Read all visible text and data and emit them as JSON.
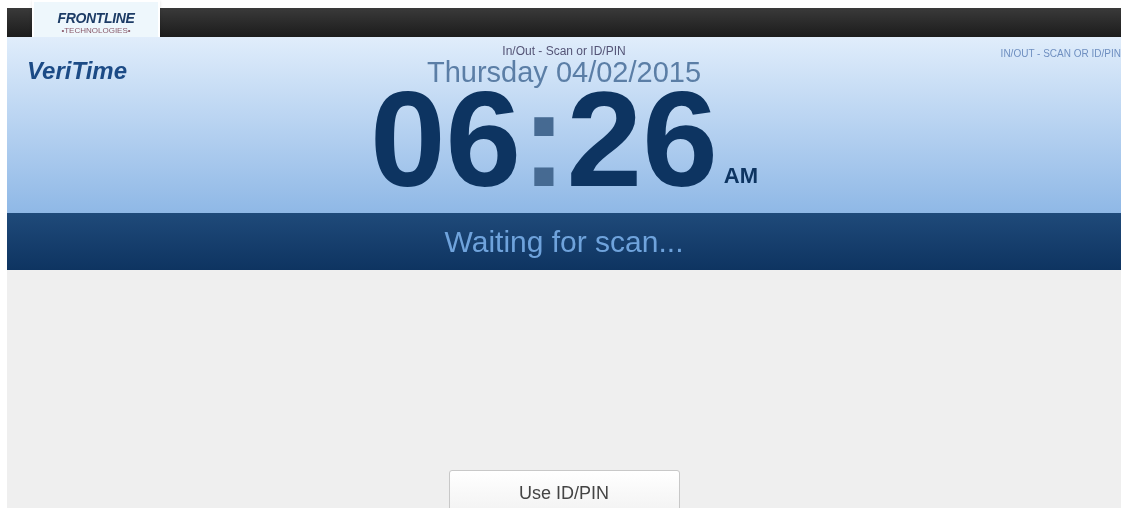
{
  "brand": {
    "company": "FRONTLINE",
    "company_tagline": "•TECHNOLOGIES•",
    "product": "VeriTime"
  },
  "header": {
    "mode_label": "In/Out - Scan or ID/PIN",
    "corner_label": "IN/OUT - SCAN OR ID/PIN",
    "date": "Thursday 04/02/2015",
    "hours": "06",
    "separator": ":",
    "minutes": "26",
    "meridiem": "AM"
  },
  "status": "Waiting for scan...",
  "buttons": [
    "Use ID/PIN"
  ]
}
